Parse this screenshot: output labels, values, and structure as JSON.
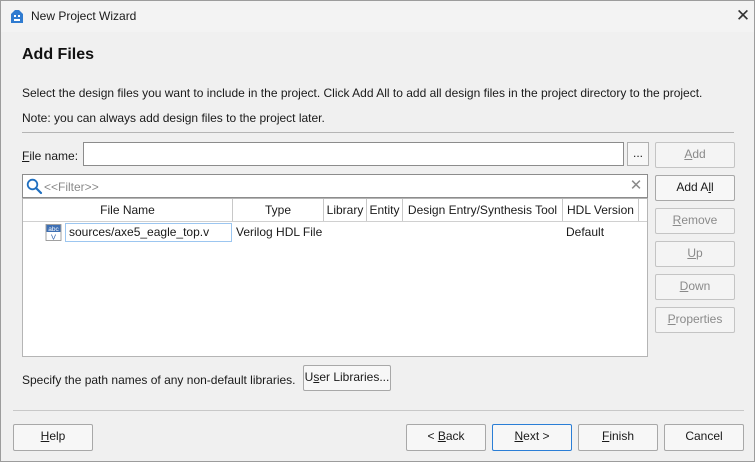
{
  "window": {
    "title": "New Project Wizard",
    "close_glyph": "✕"
  },
  "page": {
    "title": "Add Files",
    "description": "Select the design files you want to include in the project. Click Add All to add all design files in the project directory to the project.",
    "note": "Note: you can always add design files to the project later."
  },
  "file_name": {
    "label_mnemonic": "F",
    "label_rest": "ile name:",
    "value": "",
    "browse_label": "..."
  },
  "filter": {
    "placeholder": "<<Filter>>",
    "clear_glyph": "✕"
  },
  "side_buttons": {
    "add": {
      "mnemonic": "A",
      "rest": "dd",
      "enabled": false
    },
    "add_all": {
      "pre": "Add A",
      "mnemonic": "l",
      "rest": "l",
      "enabled": true
    },
    "remove": {
      "mnemonic": "R",
      "rest": "emove",
      "enabled": false
    },
    "up": {
      "mnemonic": "U",
      "rest": "p",
      "enabled": false
    },
    "down": {
      "mnemonic": "D",
      "rest": "own",
      "enabled": false
    },
    "properties": {
      "mnemonic": "P",
      "rest": "roperties",
      "enabled": false
    }
  },
  "table": {
    "columns": [
      "File Name",
      "Type",
      "Library",
      "Entity",
      "Design Entry/Synthesis Tool",
      "HDL Version"
    ],
    "rows": [
      {
        "file_name": "sources/axe5_eagle_top.v",
        "type": "Verilog HDL File",
        "library": "",
        "entity": "",
        "tool": "",
        "hdl_version": "Default",
        "icon": "verilog-file-icon",
        "icon_text_top": "abc",
        "icon_text_bottom": "V"
      }
    ]
  },
  "libraries": {
    "text": "Specify the path names of any non-default libraries.",
    "button_pre": "U",
    "button_mnemonic": "s",
    "button_rest": "er Libraries..."
  },
  "footer": {
    "help": {
      "mnemonic": "H",
      "rest": "elp"
    },
    "back": {
      "pre": "< ",
      "mnemonic": "B",
      "rest": "ack"
    },
    "next": {
      "mnemonic": "N",
      "rest": "ext >"
    },
    "finish": {
      "mnemonic": "F",
      "rest": "inish"
    },
    "cancel": {
      "label": "Cancel"
    }
  },
  "colors": {
    "accent": "#2a7ed6",
    "search_icon": "#1f6fc0",
    "disabled_text": "#8a8a8a",
    "selection_border": "#9cc6f0"
  }
}
